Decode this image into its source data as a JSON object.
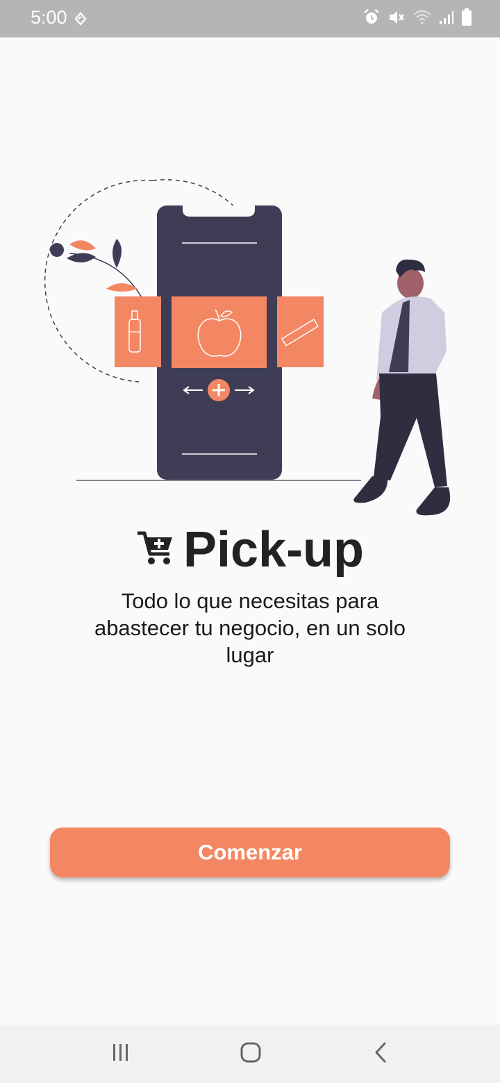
{
  "status_bar": {
    "time": "5:00",
    "icons": [
      "navigation-icon",
      "alarm-icon",
      "mute-icon",
      "wifi-icon",
      "signal-icon",
      "battery-icon"
    ]
  },
  "illustration": {
    "description_icons": [
      "bottle-icon",
      "apple-icon",
      "snack-bar-icon",
      "plus-icon",
      "arrows-icon"
    ]
  },
  "header": {
    "icon": "cart-plus-icon",
    "title": "Pick-up"
  },
  "main": {
    "subtitle": "Todo lo que necesitas para abastecer tu negocio, en un solo lugar"
  },
  "actions": {
    "start_label": "Comenzar"
  },
  "nav_bar": {
    "icons": [
      "recent-apps-icon",
      "home-icon",
      "back-icon"
    ]
  },
  "colors": {
    "accent": "#f48763",
    "dark": "#3f3d56",
    "background": "#fafafa",
    "status_bar": "#b5b5b5"
  }
}
